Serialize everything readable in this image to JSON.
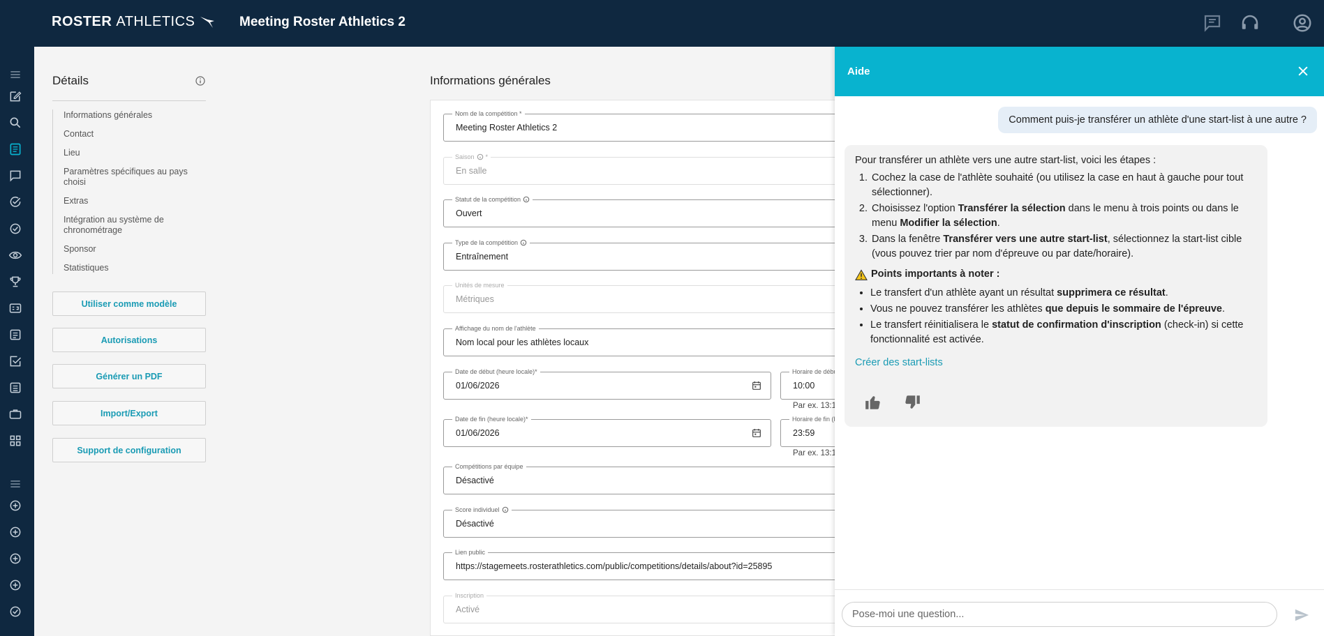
{
  "header": {
    "logo_bold": "ROSTER",
    "logo_light": "ATHLETICS",
    "title": "Meeting Roster Athletics 2",
    "icons": [
      "chat-icon",
      "support-headset-icon",
      "account-icon"
    ]
  },
  "rail": {
    "icons": [
      "menu-icon",
      "edit-icon",
      "search-icon",
      "document-list-icon",
      "chat-icon",
      "check-circle-icon",
      "check-circle-icon",
      "eye-icon",
      "trophy-icon",
      "scoreboard-icon",
      "list-icon",
      "checkbox-icon",
      "list-icon",
      "briefcase-icon",
      "grid-icon",
      "menu-icon",
      "add-circle-icon",
      "add-circle-icon",
      "add-circle-icon",
      "add-circle-icon",
      "check-circle-icon"
    ]
  },
  "details": {
    "title": "Détails",
    "nav": [
      "Informations générales",
      "Contact",
      "Lieu",
      "Paramètres spécifiques au pays choisi",
      "Extras",
      "Intégration au système de chronométrage",
      "Sponsor",
      "Statistiques"
    ],
    "buttons": [
      "Utiliser comme modèle",
      "Autorisations",
      "Générer un PDF",
      "Import/Export",
      "Support de configuration"
    ]
  },
  "form": {
    "title": "Informations générales",
    "competition_name": {
      "label": "Nom de la compétition *",
      "value": "Meeting Roster Athletics 2"
    },
    "season": {
      "label": "Saison",
      "label_suffix": "*",
      "value": "En salle"
    },
    "status": {
      "label": "Statut de la compétition",
      "value": "Ouvert"
    },
    "type": {
      "label": "Type de la compétition",
      "value": "Entraînement"
    },
    "units": {
      "label": "Unités de mesure",
      "value": "Métriques"
    },
    "athlete_display": {
      "label": "Affichage du nom de l'athlète",
      "value": "Nom local pour les athlètes locaux"
    },
    "start_date": {
      "label": "Date de début (heure locale)*",
      "value": "01/06/2026"
    },
    "start_time": {
      "label": "Horaire de débu",
      "value": "10:00",
      "hint": "Par ex. 13:1"
    },
    "end_date": {
      "label": "Date de fin (heure locale)*",
      "value": "01/06/2026"
    },
    "end_time": {
      "label": "Horaire de fin (h",
      "value": "23:59",
      "hint": "Par ex. 13:1"
    },
    "team_competitions": {
      "label": "Compétitions par équipe",
      "value": "Désactivé"
    },
    "individual_score": {
      "label": "Score individuel",
      "value": "Désactivé"
    },
    "public_link": {
      "label": "Lien public",
      "value": "https://stagemeets.rosterathletics.com/public/competitions/details/about?id=25895"
    },
    "registration": {
      "label": "Inscription",
      "value": "Activé"
    }
  },
  "help": {
    "title": "Aide",
    "user_message": "Comment puis-je transférer un athlète d'une start-list à une autre ?",
    "bot": {
      "intro": "Pour transférer un athlète vers une autre start-list, voici les étapes :",
      "steps": [
        {
          "pre": "Cochez la case de l'athlète souhaité (ou utilisez la case en haut à gauche pour tout sélectionner).",
          "b1": "",
          "mid": "",
          "b2": "",
          "post": ""
        },
        {
          "pre": "Choisissez l'option ",
          "b1": "Transférer la sélection",
          "mid": " dans le menu à trois points ou dans le menu ",
          "b2": "Modifier la sélection",
          "post": "."
        },
        {
          "pre": "Dans la fenêtre ",
          "b1": "Transférer vers une autre start-list",
          "mid": ", sélectionnez la start-list cible (vous pouvez trier par nom d'épreuve ou par date/horaire).",
          "b2": "",
          "post": ""
        }
      ],
      "warning_title": "Points importants à noter :",
      "notes": [
        {
          "pre": "Le transfert d'un athlète ayant un résultat ",
          "b": "supprimera ce résultat",
          "post": "."
        },
        {
          "pre": "Vous ne pouvez transférer les athlètes ",
          "b": "que depuis le sommaire de l'épreuve",
          "post": "."
        },
        {
          "pre": "Le transfert réinitialisera le ",
          "b": "statut de confirmation d'inscription",
          "post": " (check-in) si cette fonctionnalité est activée."
        }
      ],
      "link": "Créer des start-lists"
    },
    "input_placeholder": "Pose-moi une question..."
  },
  "colors": {
    "navy": "#0f2840",
    "accent": "#08b3cf",
    "link": "#1a9bb4"
  }
}
